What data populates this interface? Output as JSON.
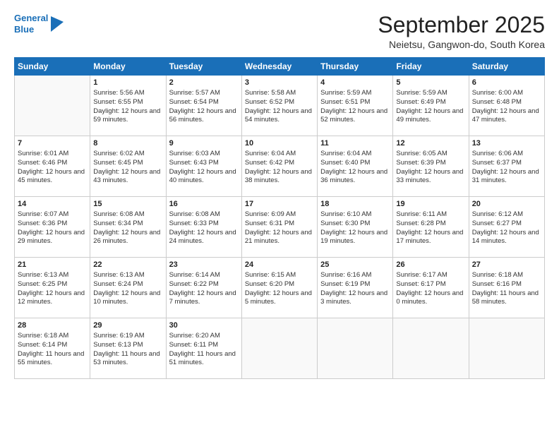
{
  "header": {
    "logo_line1": "General",
    "logo_line2": "Blue",
    "title": "September 2025",
    "subtitle": "Neietsu, Gangwon-do, South Korea"
  },
  "days": [
    "Sunday",
    "Monday",
    "Tuesday",
    "Wednesday",
    "Thursday",
    "Friday",
    "Saturday"
  ],
  "weeks": [
    [
      {
        "num": "",
        "sunrise": "",
        "sunset": "",
        "daylight": ""
      },
      {
        "num": "1",
        "sunrise": "Sunrise: 5:56 AM",
        "sunset": "Sunset: 6:55 PM",
        "daylight": "Daylight: 12 hours and 59 minutes."
      },
      {
        "num": "2",
        "sunrise": "Sunrise: 5:57 AM",
        "sunset": "Sunset: 6:54 PM",
        "daylight": "Daylight: 12 hours and 56 minutes."
      },
      {
        "num": "3",
        "sunrise": "Sunrise: 5:58 AM",
        "sunset": "Sunset: 6:52 PM",
        "daylight": "Daylight: 12 hours and 54 minutes."
      },
      {
        "num": "4",
        "sunrise": "Sunrise: 5:59 AM",
        "sunset": "Sunset: 6:51 PM",
        "daylight": "Daylight: 12 hours and 52 minutes."
      },
      {
        "num": "5",
        "sunrise": "Sunrise: 5:59 AM",
        "sunset": "Sunset: 6:49 PM",
        "daylight": "Daylight: 12 hours and 49 minutes."
      },
      {
        "num": "6",
        "sunrise": "Sunrise: 6:00 AM",
        "sunset": "Sunset: 6:48 PM",
        "daylight": "Daylight: 12 hours and 47 minutes."
      }
    ],
    [
      {
        "num": "7",
        "sunrise": "Sunrise: 6:01 AM",
        "sunset": "Sunset: 6:46 PM",
        "daylight": "Daylight: 12 hours and 45 minutes."
      },
      {
        "num": "8",
        "sunrise": "Sunrise: 6:02 AM",
        "sunset": "Sunset: 6:45 PM",
        "daylight": "Daylight: 12 hours and 43 minutes."
      },
      {
        "num": "9",
        "sunrise": "Sunrise: 6:03 AM",
        "sunset": "Sunset: 6:43 PM",
        "daylight": "Daylight: 12 hours and 40 minutes."
      },
      {
        "num": "10",
        "sunrise": "Sunrise: 6:04 AM",
        "sunset": "Sunset: 6:42 PM",
        "daylight": "Daylight: 12 hours and 38 minutes."
      },
      {
        "num": "11",
        "sunrise": "Sunrise: 6:04 AM",
        "sunset": "Sunset: 6:40 PM",
        "daylight": "Daylight: 12 hours and 36 minutes."
      },
      {
        "num": "12",
        "sunrise": "Sunrise: 6:05 AM",
        "sunset": "Sunset: 6:39 PM",
        "daylight": "Daylight: 12 hours and 33 minutes."
      },
      {
        "num": "13",
        "sunrise": "Sunrise: 6:06 AM",
        "sunset": "Sunset: 6:37 PM",
        "daylight": "Daylight: 12 hours and 31 minutes."
      }
    ],
    [
      {
        "num": "14",
        "sunrise": "Sunrise: 6:07 AM",
        "sunset": "Sunset: 6:36 PM",
        "daylight": "Daylight: 12 hours and 29 minutes."
      },
      {
        "num": "15",
        "sunrise": "Sunrise: 6:08 AM",
        "sunset": "Sunset: 6:34 PM",
        "daylight": "Daylight: 12 hours and 26 minutes."
      },
      {
        "num": "16",
        "sunrise": "Sunrise: 6:08 AM",
        "sunset": "Sunset: 6:33 PM",
        "daylight": "Daylight: 12 hours and 24 minutes."
      },
      {
        "num": "17",
        "sunrise": "Sunrise: 6:09 AM",
        "sunset": "Sunset: 6:31 PM",
        "daylight": "Daylight: 12 hours and 21 minutes."
      },
      {
        "num": "18",
        "sunrise": "Sunrise: 6:10 AM",
        "sunset": "Sunset: 6:30 PM",
        "daylight": "Daylight: 12 hours and 19 minutes."
      },
      {
        "num": "19",
        "sunrise": "Sunrise: 6:11 AM",
        "sunset": "Sunset: 6:28 PM",
        "daylight": "Daylight: 12 hours and 17 minutes."
      },
      {
        "num": "20",
        "sunrise": "Sunrise: 6:12 AM",
        "sunset": "Sunset: 6:27 PM",
        "daylight": "Daylight: 12 hours and 14 minutes."
      }
    ],
    [
      {
        "num": "21",
        "sunrise": "Sunrise: 6:13 AM",
        "sunset": "Sunset: 6:25 PM",
        "daylight": "Daylight: 12 hours and 12 minutes."
      },
      {
        "num": "22",
        "sunrise": "Sunrise: 6:13 AM",
        "sunset": "Sunset: 6:24 PM",
        "daylight": "Daylight: 12 hours and 10 minutes."
      },
      {
        "num": "23",
        "sunrise": "Sunrise: 6:14 AM",
        "sunset": "Sunset: 6:22 PM",
        "daylight": "Daylight: 12 hours and 7 minutes."
      },
      {
        "num": "24",
        "sunrise": "Sunrise: 6:15 AM",
        "sunset": "Sunset: 6:20 PM",
        "daylight": "Daylight: 12 hours and 5 minutes."
      },
      {
        "num": "25",
        "sunrise": "Sunrise: 6:16 AM",
        "sunset": "Sunset: 6:19 PM",
        "daylight": "Daylight: 12 hours and 3 minutes."
      },
      {
        "num": "26",
        "sunrise": "Sunrise: 6:17 AM",
        "sunset": "Sunset: 6:17 PM",
        "daylight": "Daylight: 12 hours and 0 minutes."
      },
      {
        "num": "27",
        "sunrise": "Sunrise: 6:18 AM",
        "sunset": "Sunset: 6:16 PM",
        "daylight": "Daylight: 11 hours and 58 minutes."
      }
    ],
    [
      {
        "num": "28",
        "sunrise": "Sunrise: 6:18 AM",
        "sunset": "Sunset: 6:14 PM",
        "daylight": "Daylight: 11 hours and 55 minutes."
      },
      {
        "num": "29",
        "sunrise": "Sunrise: 6:19 AM",
        "sunset": "Sunset: 6:13 PM",
        "daylight": "Daylight: 11 hours and 53 minutes."
      },
      {
        "num": "30",
        "sunrise": "Sunrise: 6:20 AM",
        "sunset": "Sunset: 6:11 PM",
        "daylight": "Daylight: 11 hours and 51 minutes."
      },
      {
        "num": "",
        "sunrise": "",
        "sunset": "",
        "daylight": ""
      },
      {
        "num": "",
        "sunrise": "",
        "sunset": "",
        "daylight": ""
      },
      {
        "num": "",
        "sunrise": "",
        "sunset": "",
        "daylight": ""
      },
      {
        "num": "",
        "sunrise": "",
        "sunset": "",
        "daylight": ""
      }
    ]
  ]
}
